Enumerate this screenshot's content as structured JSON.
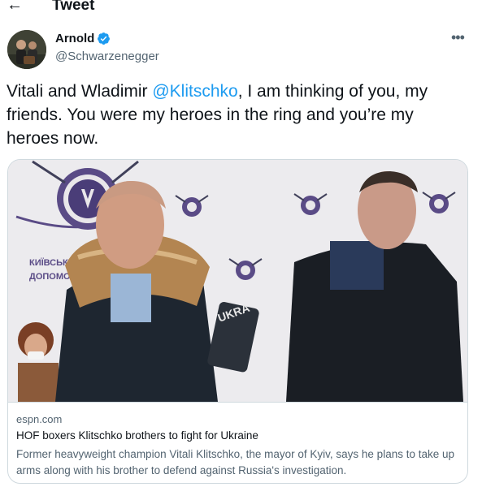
{
  "header": {
    "back_icon": "arrow-left-icon",
    "title": "Tweet"
  },
  "author": {
    "name": "Arnold",
    "handle": "@Schwarzenegger",
    "verified": true
  },
  "tweet": {
    "text_before": "Vitali and Wladimir ",
    "mention": "@Klitschko",
    "text_after": ", I am thinking of you, my friends. You were my heroes in the ring and you’re my heroes now."
  },
  "card": {
    "domain": "espn.com",
    "title": "HOF boxers Klitschko brothers to fight for Ukraine",
    "description": "Former heavyweight champion Vitali Klitschko, the mayor of Kyiv, says he plans to take up arms along with his brother to defend against Russia's investigation.",
    "image_texts": {
      "banner_left": "КИЇВСЬКИЙ",
      "banner_left_2": "ДОПОМОГ",
      "jacket": "UKRA"
    }
  },
  "colors": {
    "accent": "#1d9bf0",
    "secondary_text": "#536471",
    "border": "#cfd9de"
  }
}
